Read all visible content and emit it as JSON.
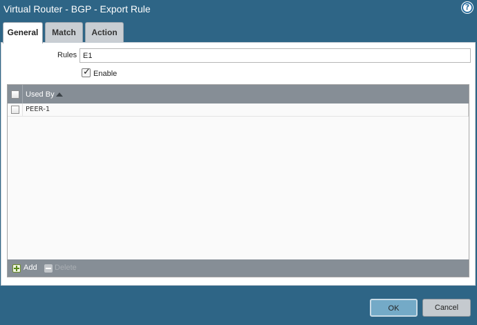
{
  "dialog": {
    "title": "Virtual Router - BGP - Export Rule",
    "help_icon": "help-icon"
  },
  "tabs": [
    {
      "label": "General",
      "active": true
    },
    {
      "label": "Match",
      "active": false
    },
    {
      "label": "Action",
      "active": false
    }
  ],
  "form": {
    "rules_label": "Rules",
    "rules_value": "E1",
    "enable_label": "Enable",
    "enable_checked": true
  },
  "grid": {
    "column_header": "Used By",
    "sort_direction": "ascending",
    "rows": [
      {
        "value": "PEER-1",
        "checked": false
      }
    ],
    "footer": {
      "add_label": "Add",
      "delete_label": "Delete",
      "delete_disabled": true
    }
  },
  "buttons": {
    "ok_label": "OK",
    "cancel_label": "Cancel"
  },
  "colors": {
    "frame": "#2e6586",
    "grid_header": "#868e96",
    "ok_button": "#74aac7"
  }
}
